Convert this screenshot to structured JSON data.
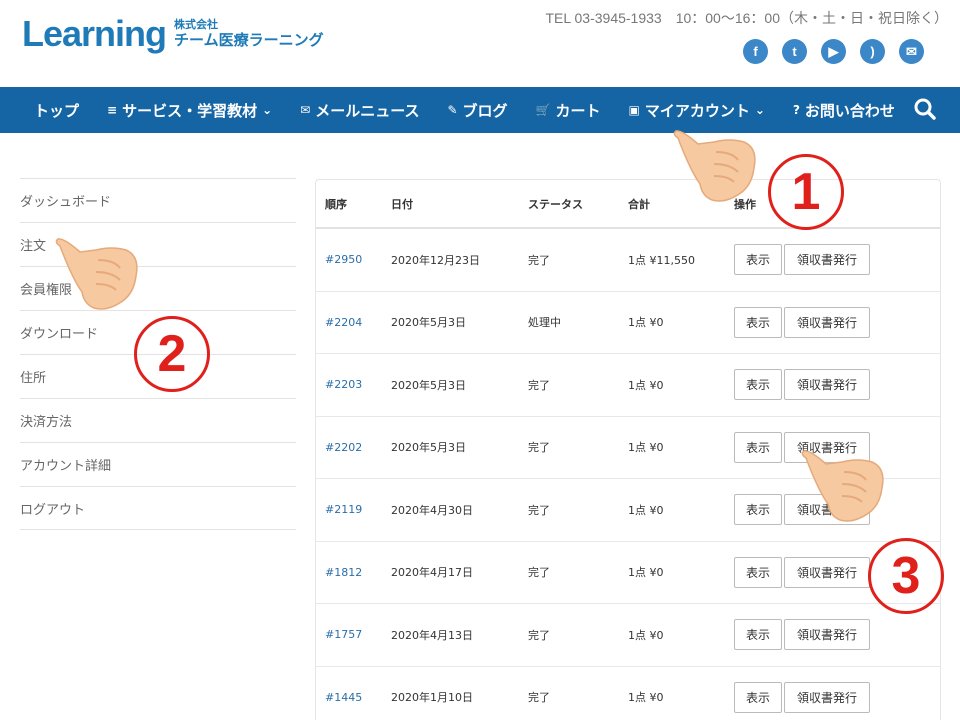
{
  "header": {
    "logo_main": "Learning",
    "logo_sub_top": "株式会社",
    "logo_sub_bottom": "チーム医療ラーニング",
    "contact": "TEL 03-3945-1933　10：00〜16：00（木・土・日・祝日除く）",
    "social_icons": [
      {
        "name": "facebook-icon",
        "glyph": "f"
      },
      {
        "name": "twitter-icon",
        "glyph": "t"
      },
      {
        "name": "youtube-icon",
        "glyph": "▶"
      },
      {
        "name": "rss-icon",
        "glyph": ")"
      },
      {
        "name": "mail-icon",
        "glyph": "✉"
      }
    ],
    "brand_color": "#1e7bb8"
  },
  "nav": {
    "color": "#1565a5",
    "items": [
      {
        "label": "トップ",
        "icon": ""
      },
      {
        "label": "サービス・学習教材",
        "icon": "≡",
        "dropdown": "⌄"
      },
      {
        "label": "メールニュース",
        "icon": "✉"
      },
      {
        "label": "ブログ",
        "icon": "✎"
      },
      {
        "label": "カート",
        "icon": "🛒"
      },
      {
        "label": "マイアカウント",
        "icon": "▣",
        "dropdown": "⌄"
      },
      {
        "label": "お問い合わせ",
        "icon": "?"
      }
    ]
  },
  "sidebar": {
    "items": [
      "ダッシュボード",
      "注文",
      "会員権限",
      "ダウンロード",
      "住所",
      "決済方法",
      "アカウント詳細",
      "ログアウト"
    ]
  },
  "orders": {
    "columns": [
      "順序",
      "日付",
      "ステータス",
      "合計",
      "操作"
    ],
    "view_label": "表示",
    "receipt_label": "領収書発行",
    "rows": [
      {
        "number": "#2950",
        "date": "2020年12月23日",
        "status": "完了",
        "total": "1点 ¥11,550"
      },
      {
        "number": "#2204",
        "date": "2020年5月3日",
        "status": "処理中",
        "total": "1点 ¥0"
      },
      {
        "number": "#2203",
        "date": "2020年5月3日",
        "status": "完了",
        "total": "1点 ¥0"
      },
      {
        "number": "#2202",
        "date": "2020年5月3日",
        "status": "完了",
        "total": "1点 ¥0"
      },
      {
        "number": "#2119",
        "date": "2020年4月30日",
        "status": "完了",
        "total": "1点 ¥0"
      },
      {
        "number": "#1812",
        "date": "2020年4月17日",
        "status": "完了",
        "total": "1点 ¥0"
      },
      {
        "number": "#1757",
        "date": "2020年4月13日",
        "status": "完了",
        "total": "1点 ¥0"
      },
      {
        "number": "#1445",
        "date": "2020年1月10日",
        "status": "完了",
        "total": "1点 ¥0"
      }
    ]
  },
  "annotations": {
    "markers": [
      "1",
      "2",
      "3"
    ],
    "marker_color": "#e0201b"
  }
}
